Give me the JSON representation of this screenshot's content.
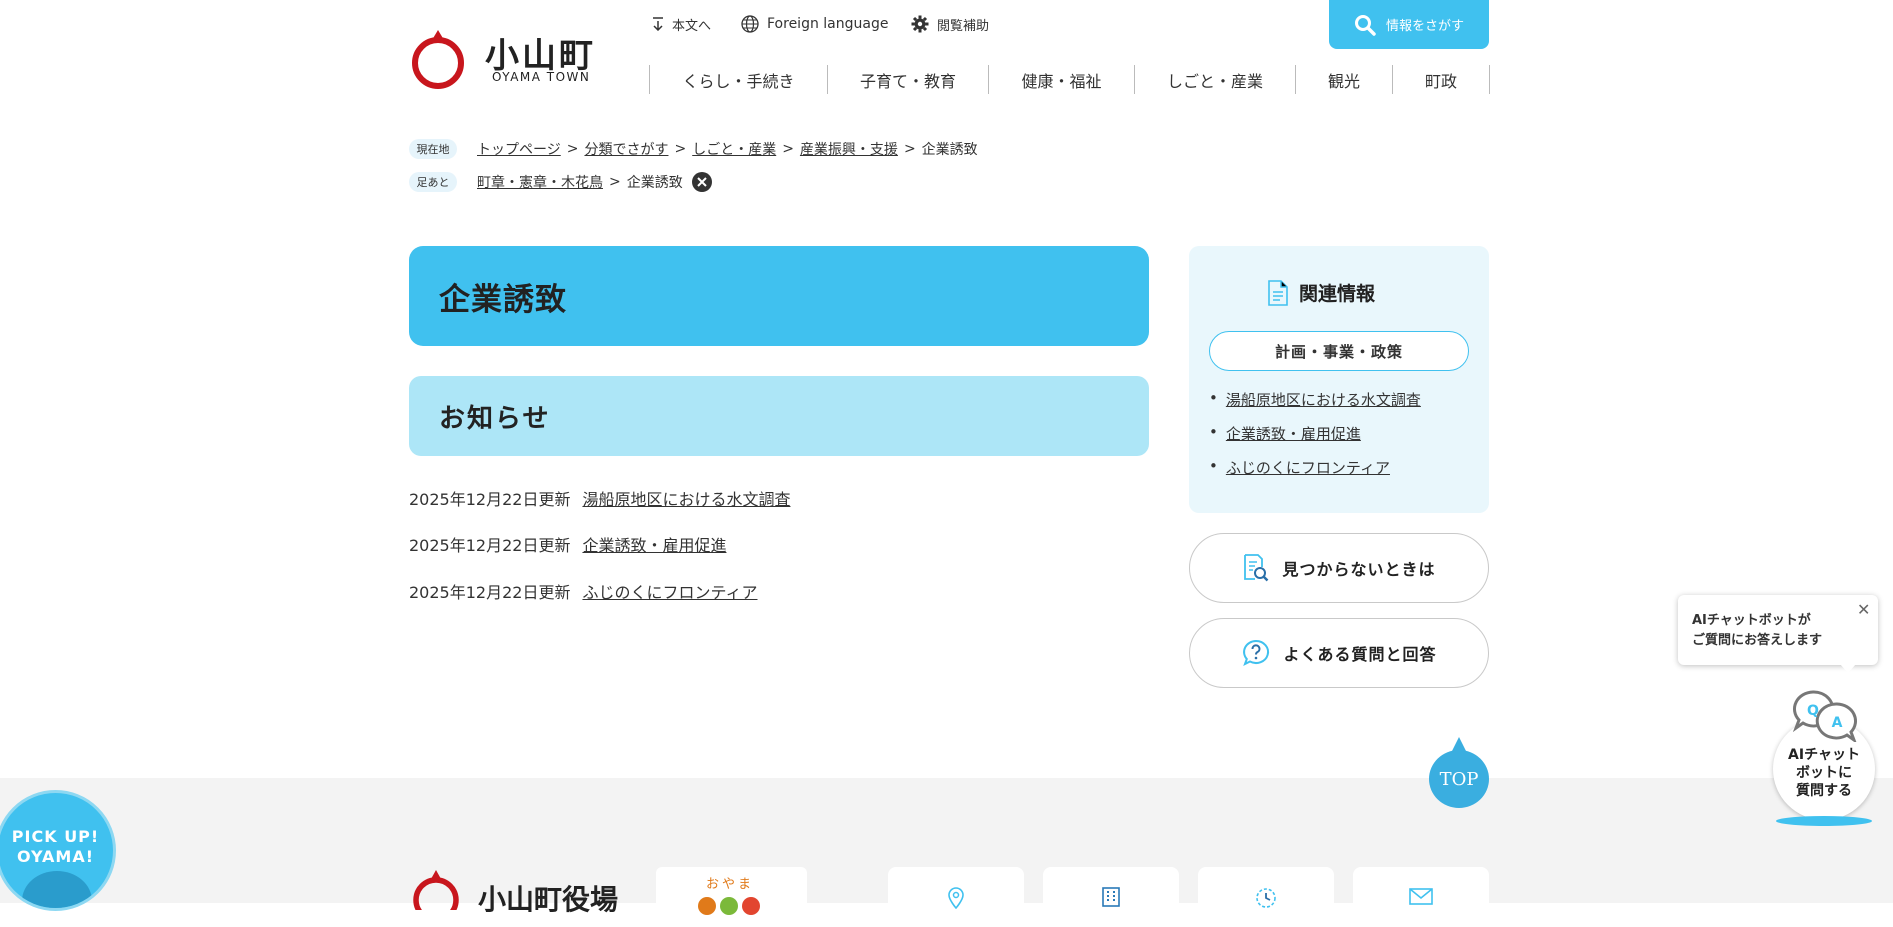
{
  "colors": {
    "accent": "#40c1ef",
    "accent_light": "#ade6f7",
    "panel_bg": "#e9f7fc",
    "logo_red": "#c8161d"
  },
  "header": {
    "logo_name": "小山町",
    "logo_sub": "OYAMA TOWN",
    "utility": {
      "skip": "本文へ",
      "foreign": "Foreign language",
      "accessibility": "閲覧補助"
    },
    "search_label": "情報をさがす",
    "nav": [
      "くらし・手続き",
      "子育て・教育",
      "健康・福祉",
      "しごと・産業",
      "観光",
      "町政"
    ]
  },
  "breadcrumb": {
    "current_badge": "現在地",
    "current": [
      "トップページ",
      "分類でさがす",
      "しごと・産業",
      "産業振興・支援",
      "企業誘致"
    ],
    "history_badge": "足あと",
    "history": [
      "町章・憲章・木花鳥",
      "企業誘致"
    ]
  },
  "main": {
    "title": "企業誘致",
    "section": "お知らせ",
    "news": [
      {
        "date": "2025年12月22日更新",
        "title": "湯船原地区における水文調査"
      },
      {
        "date": "2025年12月22日更新",
        "title": "企業誘致・雇用促進"
      },
      {
        "date": "2025年12月22日更新",
        "title": "ふじのくにフロンティア"
      }
    ]
  },
  "related": {
    "heading": "関連情報",
    "category": "計画・事業・政策",
    "links": [
      "湯船原地区における水文調査",
      "企業誘致・雇用促進",
      "ふじのくにフロンティア"
    ]
  },
  "side_buttons": {
    "not_found": "見つからないときは",
    "faq": "よくある質問と回答"
  },
  "top_button": "TOP",
  "pickup": {
    "line1": "PICK UP!",
    "line2": "OYAMA!"
  },
  "footer": {
    "office_name": "小山町役場",
    "oyama_label": "おやま"
  },
  "ai_chat": {
    "bubble_line1": "AIチャットボットが",
    "bubble_line2": "ご質問にお答えします",
    "launcher_line1": "AIチャット",
    "launcher_line2": "ボットに",
    "launcher_line3": "質問する",
    "icon_q": "Q",
    "icon_a": "A"
  }
}
